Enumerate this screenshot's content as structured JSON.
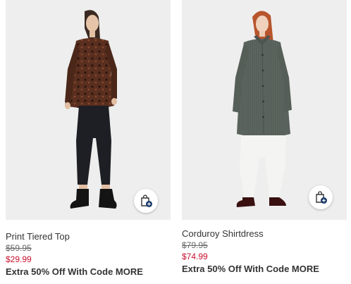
{
  "products": [
    {
      "name": "Print Tiered Top",
      "original_price": "$59.95",
      "sale_price": "$29.99",
      "promo": "Extra 50% Off With Code MORE",
      "image_alt": "model wearing print tiered top",
      "bag_icon": "shopping-bag-add-icon"
    },
    {
      "name": "Corduroy Shirtdress",
      "original_price": "$79.95",
      "sale_price": "$74.99",
      "promo": "Extra 50% Off With Code MORE",
      "image_alt": "model wearing corduroy shirtdress",
      "bag_icon": "shopping-bag-add-icon"
    }
  ],
  "colors": {
    "sale_price": "#c8102e",
    "photo_background": "#eeeeee",
    "bag_badge": "#1a3a6b"
  }
}
